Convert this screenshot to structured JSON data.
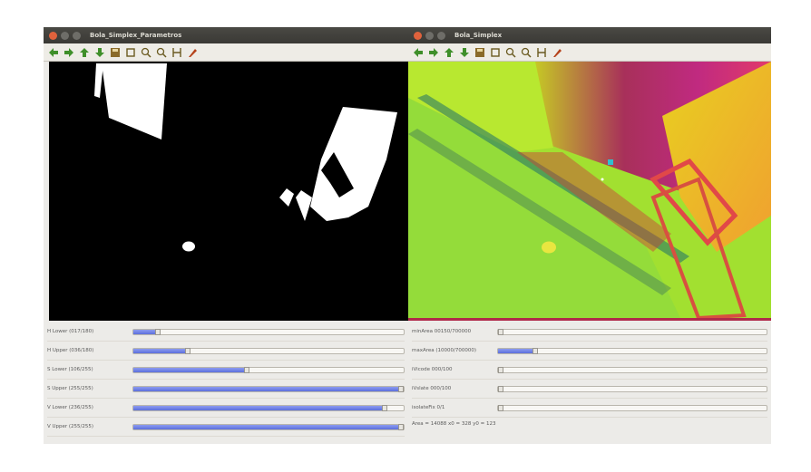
{
  "left_window": {
    "title": "Bola_Simplex_Parametros",
    "toolbar": [
      "arrow-left-icon",
      "arrow-right-icon",
      "arrow-up-icon",
      "arrow-down-icon",
      "save-icon",
      "pan-icon",
      "zoom-in-icon",
      "zoom-out-icon",
      "zoom-fit-icon",
      "properties-icon"
    ],
    "sliders": [
      {
        "label": "H Lower  (017/180)",
        "fraction": 0.09
      },
      {
        "label": "H Upper  (036/180)",
        "fraction": 0.2
      },
      {
        "label": "S Lower  (106/255)",
        "fraction": 0.42
      },
      {
        "label": "S Upper  (255/255)",
        "fraction": 1.0
      },
      {
        "label": "V Lower  (236/255)",
        "fraction": 0.93
      },
      {
        "label": "V Upper  (255/255)",
        "fraction": 1.0
      }
    ]
  },
  "right_window": {
    "title": "Bola_Simplex",
    "toolbar": [
      "arrow-left-icon",
      "arrow-right-icon",
      "arrow-up-icon",
      "arrow-down-icon",
      "save-icon",
      "pan-icon",
      "zoom-in-icon",
      "zoom-out-icon",
      "zoom-fit-icon",
      "properties-icon"
    ],
    "sliders": [
      {
        "label": "minArea  00150/700000",
        "fraction": 0.0
      },
      {
        "label": "maxArea  (10000/700000)",
        "fraction": 0.14
      },
      {
        "label": "iVicode  000/100",
        "fraction": 0.0
      },
      {
        "label": "iVslate  000/100",
        "fraction": 0.0
      },
      {
        "label": "isolateFix 0/1",
        "fraction": 0.0
      }
    ],
    "status": "Area = 14088  x0 = 328  y0 = 123"
  },
  "colors": {
    "accent": "#5c6fdc",
    "arrow_green": "#3f8f2a",
    "bar_red": "#b02a4a"
  }
}
